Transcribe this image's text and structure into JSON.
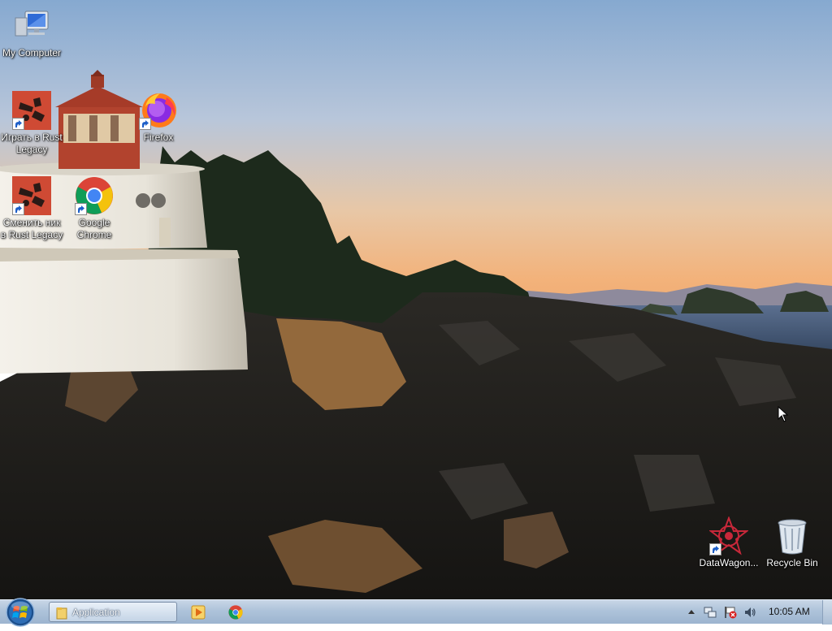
{
  "desktop": {
    "icons": [
      {
        "label": "My Computer",
        "icon": "computer-icon"
      },
      {
        "label": "Играть в Rust Legacy",
        "icon": "rust-game-icon"
      },
      {
        "label": "Firefox",
        "icon": "firefox-icon"
      },
      {
        "label": "Сменить ник в Rust Legacy",
        "icon": "rust-game-icon"
      },
      {
        "label": "Google Chrome",
        "icon": "chrome-icon"
      },
      {
        "label": "DataWagon...",
        "icon": "datawagon-icon"
      },
      {
        "label": "Recycle Bin",
        "icon": "recycle-bin-icon"
      }
    ]
  },
  "taskbar": {
    "start": "windows-start-orb-icon",
    "app_button_label": "Application",
    "pinned": [
      "media-player-icon",
      "chrome-icon"
    ],
    "tray_icons": [
      "show-hidden-icons-arrow",
      "network-icon",
      "action-center-flag-icon",
      "volume-icon"
    ],
    "clock": "10:05 AM"
  },
  "colors": {
    "taskbar_top": "#c8d6e6",
    "taskbar_bottom": "#9cb4cf",
    "sky_top": "#8aaed4",
    "sky_horizon": "#f1b47a"
  }
}
